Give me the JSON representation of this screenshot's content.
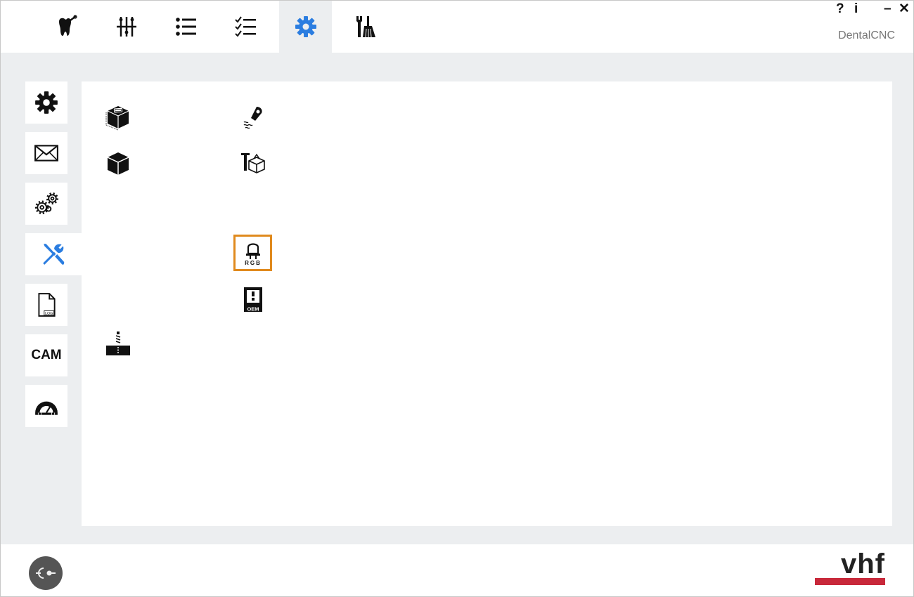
{
  "window": {
    "brand": "DentalCNC",
    "help_label": "?",
    "info_label": "i",
    "minimize_label": "–",
    "close_label": "✕"
  },
  "top_tabs": [
    {
      "id": "tooth",
      "icon": "tooth-icon",
      "active": false
    },
    {
      "id": "adjust",
      "icon": "adjust-sliders-icon",
      "active": false
    },
    {
      "id": "list",
      "icon": "list-icon",
      "active": false
    },
    {
      "id": "checklist",
      "icon": "checklist-icon",
      "active": false
    },
    {
      "id": "settings",
      "icon": "gear-icon",
      "active": true
    },
    {
      "id": "service",
      "icon": "wrench-broom-icon",
      "active": false
    }
  ],
  "sidebar": [
    {
      "icon": "gear-icon",
      "active": false
    },
    {
      "icon": "envelope-icon",
      "active": false
    },
    {
      "icon": "gears-icon",
      "active": false
    },
    {
      "icon": "tools-icon",
      "active": true
    },
    {
      "icon": "log-file-icon",
      "label": "LOG",
      "active": false
    },
    {
      "icon": "cam-icon",
      "label": "CAM",
      "active": false
    },
    {
      "icon": "protractor-icon",
      "active": false
    }
  ],
  "panel_tiles": [
    {
      "icon": "cube-label-icon",
      "highlighted": false
    },
    {
      "icon": "pin-signal-icon",
      "highlighted": false
    },
    {
      "icon": "cube-icon",
      "highlighted": false
    },
    {
      "icon": "tool-box-icon",
      "highlighted": false
    },
    {
      "icon": "rgb-led-icon",
      "label": "RGB",
      "highlighted": true
    },
    {
      "icon": "oem-icon",
      "label": "OEM",
      "highlighted": false
    },
    {
      "icon": "milling-tool-icon",
      "highlighted": false
    }
  ],
  "colors": {
    "accent": "#2b7de0",
    "highlight": "#e08a1e",
    "logo_red": "#c8283a",
    "background": "#eceef0"
  },
  "footer": {
    "logo_text": "vhf"
  }
}
